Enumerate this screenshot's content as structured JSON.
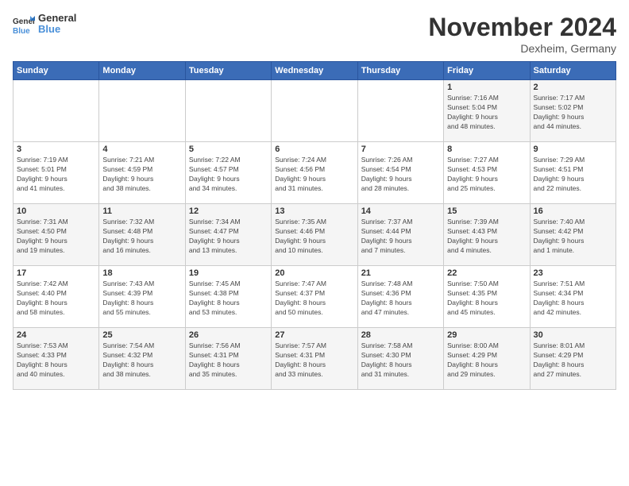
{
  "logo": {
    "line1": "General",
    "line2": "Blue"
  },
  "title": "November 2024",
  "subtitle": "Dexheim, Germany",
  "headers": [
    "Sunday",
    "Monday",
    "Tuesday",
    "Wednesday",
    "Thursday",
    "Friday",
    "Saturday"
  ],
  "weeks": [
    [
      {
        "day": "",
        "info": ""
      },
      {
        "day": "",
        "info": ""
      },
      {
        "day": "",
        "info": ""
      },
      {
        "day": "",
        "info": ""
      },
      {
        "day": "",
        "info": ""
      },
      {
        "day": "1",
        "info": "Sunrise: 7:16 AM\nSunset: 5:04 PM\nDaylight: 9 hours\nand 48 minutes."
      },
      {
        "day": "2",
        "info": "Sunrise: 7:17 AM\nSunset: 5:02 PM\nDaylight: 9 hours\nand 44 minutes."
      }
    ],
    [
      {
        "day": "3",
        "info": "Sunrise: 7:19 AM\nSunset: 5:01 PM\nDaylight: 9 hours\nand 41 minutes."
      },
      {
        "day": "4",
        "info": "Sunrise: 7:21 AM\nSunset: 4:59 PM\nDaylight: 9 hours\nand 38 minutes."
      },
      {
        "day": "5",
        "info": "Sunrise: 7:22 AM\nSunset: 4:57 PM\nDaylight: 9 hours\nand 34 minutes."
      },
      {
        "day": "6",
        "info": "Sunrise: 7:24 AM\nSunset: 4:56 PM\nDaylight: 9 hours\nand 31 minutes."
      },
      {
        "day": "7",
        "info": "Sunrise: 7:26 AM\nSunset: 4:54 PM\nDaylight: 9 hours\nand 28 minutes."
      },
      {
        "day": "8",
        "info": "Sunrise: 7:27 AM\nSunset: 4:53 PM\nDaylight: 9 hours\nand 25 minutes."
      },
      {
        "day": "9",
        "info": "Sunrise: 7:29 AM\nSunset: 4:51 PM\nDaylight: 9 hours\nand 22 minutes."
      }
    ],
    [
      {
        "day": "10",
        "info": "Sunrise: 7:31 AM\nSunset: 4:50 PM\nDaylight: 9 hours\nand 19 minutes."
      },
      {
        "day": "11",
        "info": "Sunrise: 7:32 AM\nSunset: 4:48 PM\nDaylight: 9 hours\nand 16 minutes."
      },
      {
        "day": "12",
        "info": "Sunrise: 7:34 AM\nSunset: 4:47 PM\nDaylight: 9 hours\nand 13 minutes."
      },
      {
        "day": "13",
        "info": "Sunrise: 7:35 AM\nSunset: 4:46 PM\nDaylight: 9 hours\nand 10 minutes."
      },
      {
        "day": "14",
        "info": "Sunrise: 7:37 AM\nSunset: 4:44 PM\nDaylight: 9 hours\nand 7 minutes."
      },
      {
        "day": "15",
        "info": "Sunrise: 7:39 AM\nSunset: 4:43 PM\nDaylight: 9 hours\nand 4 minutes."
      },
      {
        "day": "16",
        "info": "Sunrise: 7:40 AM\nSunset: 4:42 PM\nDaylight: 9 hours\nand 1 minute."
      }
    ],
    [
      {
        "day": "17",
        "info": "Sunrise: 7:42 AM\nSunset: 4:40 PM\nDaylight: 8 hours\nand 58 minutes."
      },
      {
        "day": "18",
        "info": "Sunrise: 7:43 AM\nSunset: 4:39 PM\nDaylight: 8 hours\nand 55 minutes."
      },
      {
        "day": "19",
        "info": "Sunrise: 7:45 AM\nSunset: 4:38 PM\nDaylight: 8 hours\nand 53 minutes."
      },
      {
        "day": "20",
        "info": "Sunrise: 7:47 AM\nSunset: 4:37 PM\nDaylight: 8 hours\nand 50 minutes."
      },
      {
        "day": "21",
        "info": "Sunrise: 7:48 AM\nSunset: 4:36 PM\nDaylight: 8 hours\nand 47 minutes."
      },
      {
        "day": "22",
        "info": "Sunrise: 7:50 AM\nSunset: 4:35 PM\nDaylight: 8 hours\nand 45 minutes."
      },
      {
        "day": "23",
        "info": "Sunrise: 7:51 AM\nSunset: 4:34 PM\nDaylight: 8 hours\nand 42 minutes."
      }
    ],
    [
      {
        "day": "24",
        "info": "Sunrise: 7:53 AM\nSunset: 4:33 PM\nDaylight: 8 hours\nand 40 minutes."
      },
      {
        "day": "25",
        "info": "Sunrise: 7:54 AM\nSunset: 4:32 PM\nDaylight: 8 hours\nand 38 minutes."
      },
      {
        "day": "26",
        "info": "Sunrise: 7:56 AM\nSunset: 4:31 PM\nDaylight: 8 hours\nand 35 minutes."
      },
      {
        "day": "27",
        "info": "Sunrise: 7:57 AM\nSunset: 4:31 PM\nDaylight: 8 hours\nand 33 minutes."
      },
      {
        "day": "28",
        "info": "Sunrise: 7:58 AM\nSunset: 4:30 PM\nDaylight: 8 hours\nand 31 minutes."
      },
      {
        "day": "29",
        "info": "Sunrise: 8:00 AM\nSunset: 4:29 PM\nDaylight: 8 hours\nand 29 minutes."
      },
      {
        "day": "30",
        "info": "Sunrise: 8:01 AM\nSunset: 4:29 PM\nDaylight: 8 hours\nand 27 minutes."
      }
    ]
  ]
}
